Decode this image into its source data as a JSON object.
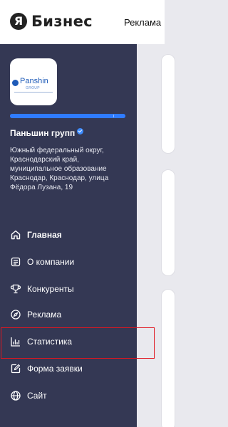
{
  "header": {
    "logo_letter": "Я",
    "logo_text": "Бизнес",
    "nav_link": "Реклама"
  },
  "company": {
    "logo_name": "Panshin",
    "logo_sub": "GROUP",
    "name": "Паньшин групп",
    "address": "Южный федеральный округ, Краснодарский край, муниципальное образование Краснодар, Краснодар, улица Фёдора Лузана, 19",
    "profile_progress_percent": 100
  },
  "nav": {
    "items": [
      {
        "label": "Главная",
        "icon": "home-icon",
        "active": true
      },
      {
        "label": "О компании",
        "icon": "document-icon",
        "active": false
      },
      {
        "label": "Конкуренты",
        "icon": "trophy-icon",
        "active": false
      },
      {
        "label": "Реклама",
        "icon": "compass-icon",
        "active": false
      },
      {
        "label": "Статистика",
        "icon": "bar-chart-icon",
        "active": false,
        "highlighted": true
      },
      {
        "label": "Форма заявки",
        "icon": "edit-icon",
        "active": false
      },
      {
        "label": "Сайт",
        "icon": "globe-icon",
        "active": false
      }
    ]
  },
  "colors": {
    "sidebar_bg": "#343854",
    "progress": "#2f7bff",
    "verified": "#3d8cff",
    "highlight": "#e0161f"
  }
}
